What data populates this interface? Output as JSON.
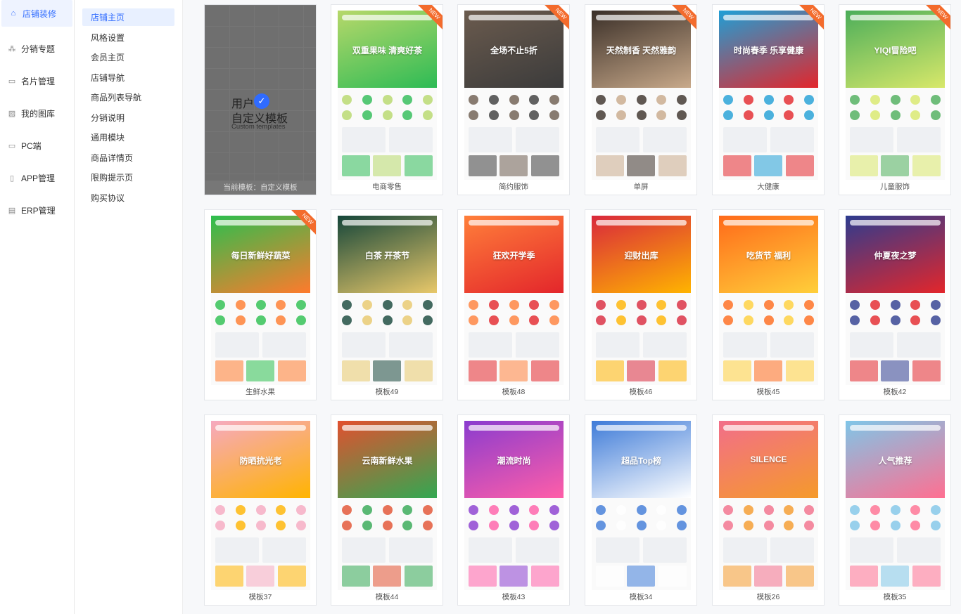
{
  "nav": {
    "items": [
      {
        "icon": "store-decor-icon",
        "label": "店铺装修",
        "active": true
      },
      {
        "icon": "distribution-icon",
        "label": "分销专题"
      },
      {
        "icon": "card-icon",
        "label": "名片管理"
      },
      {
        "icon": "gallery-icon",
        "label": "我的图库"
      },
      {
        "icon": "monitor-icon",
        "label": "PC端"
      },
      {
        "icon": "phone-icon",
        "label": "APP管理"
      },
      {
        "icon": "erp-icon",
        "label": "ERP管理"
      }
    ]
  },
  "subnav": {
    "items": [
      {
        "label": "店铺主页",
        "active": true
      },
      {
        "label": "风格设置"
      },
      {
        "label": "会员主页"
      },
      {
        "label": "店铺导航"
      },
      {
        "label": "商品列表导航"
      },
      {
        "label": "分销说明"
      },
      {
        "label": "通用模块"
      },
      {
        "label": "商品详情页"
      },
      {
        "label": "限购提示页"
      },
      {
        "label": "购买协议"
      }
    ]
  },
  "custom": {
    "line1": "用户",
    "line2": "自定义模板",
    "line3": "Custom templates",
    "caption": "当前模板：自定义模板"
  },
  "ribbon_label": "NEW",
  "templates": [
    {
      "name": "电商零售",
      "new": true,
      "theme": "#b7d86a",
      "accent": "#2dbb55",
      "banner_text": "双重果味 清爽好茶"
    },
    {
      "name": "简约服饰",
      "new": true,
      "theme": "#6b5b4e",
      "accent": "#3b3b3b",
      "banner_text": "全场不止5折"
    },
    {
      "name": "单屏",
      "new": true,
      "theme": "#3a2f28",
      "accent": "#c8a98a",
      "banner_text": "天然制香 天然雅韵"
    },
    {
      "name": "大健康",
      "new": true,
      "theme": "#1f9fd6",
      "accent": "#e3262b",
      "banner_text": "时尚春季 乐享健康"
    },
    {
      "name": "儿童服饰",
      "new": true,
      "theme": "#4cae5a",
      "accent": "#d8e86a",
      "banner_text": "YIQI冒险吧"
    },
    {
      "name": "生鲜水果",
      "new": true,
      "theme": "#2bbf4e",
      "accent": "#ff7a2c",
      "banner_text": "每日新鲜好蔬菜"
    },
    {
      "name": "模板49",
      "theme": "#15463a",
      "accent": "#e8c86a",
      "banner_text": "白茶 开茶节"
    },
    {
      "name": "模板48",
      "theme": "#ff7f3a",
      "accent": "#e3262b",
      "banner_text": "狂欢开学季"
    },
    {
      "name": "模板46",
      "theme": "#d9283c",
      "accent": "#ffb400",
      "banner_text": "迎财出库"
    },
    {
      "name": "模板45",
      "theme": "#ff6a1a",
      "accent": "#ffcf3a",
      "banner_text": "吃货节 福利"
    },
    {
      "name": "模板42",
      "theme": "#2d3c8f",
      "accent": "#e3262b",
      "banner_text": "仲夏夜之梦"
    },
    {
      "name": "模板37",
      "theme": "#f6a9c0",
      "accent": "#ffb400",
      "banner_text": "防晒抗光老"
    },
    {
      "name": "模板44",
      "theme": "#e2502f",
      "accent": "#32a852",
      "banner_text": "云南新鲜水果"
    },
    {
      "name": "模板43",
      "theme": "#8a3ccf",
      "accent": "#ff5ea8",
      "banner_text": "潮流时尚"
    },
    {
      "name": "模板34",
      "theme": "#3e7bd8",
      "accent": "#ffffff",
      "banner_text": "超品Top榜"
    },
    {
      "name": "模板26",
      "theme": "#f26e8a",
      "accent": "#f59a2b",
      "banner_text": "SILENCE"
    },
    {
      "name": "模板35",
      "theme": "#7fc6e8",
      "accent": "#ff6f91",
      "banner_text": "人气推荐"
    }
  ]
}
